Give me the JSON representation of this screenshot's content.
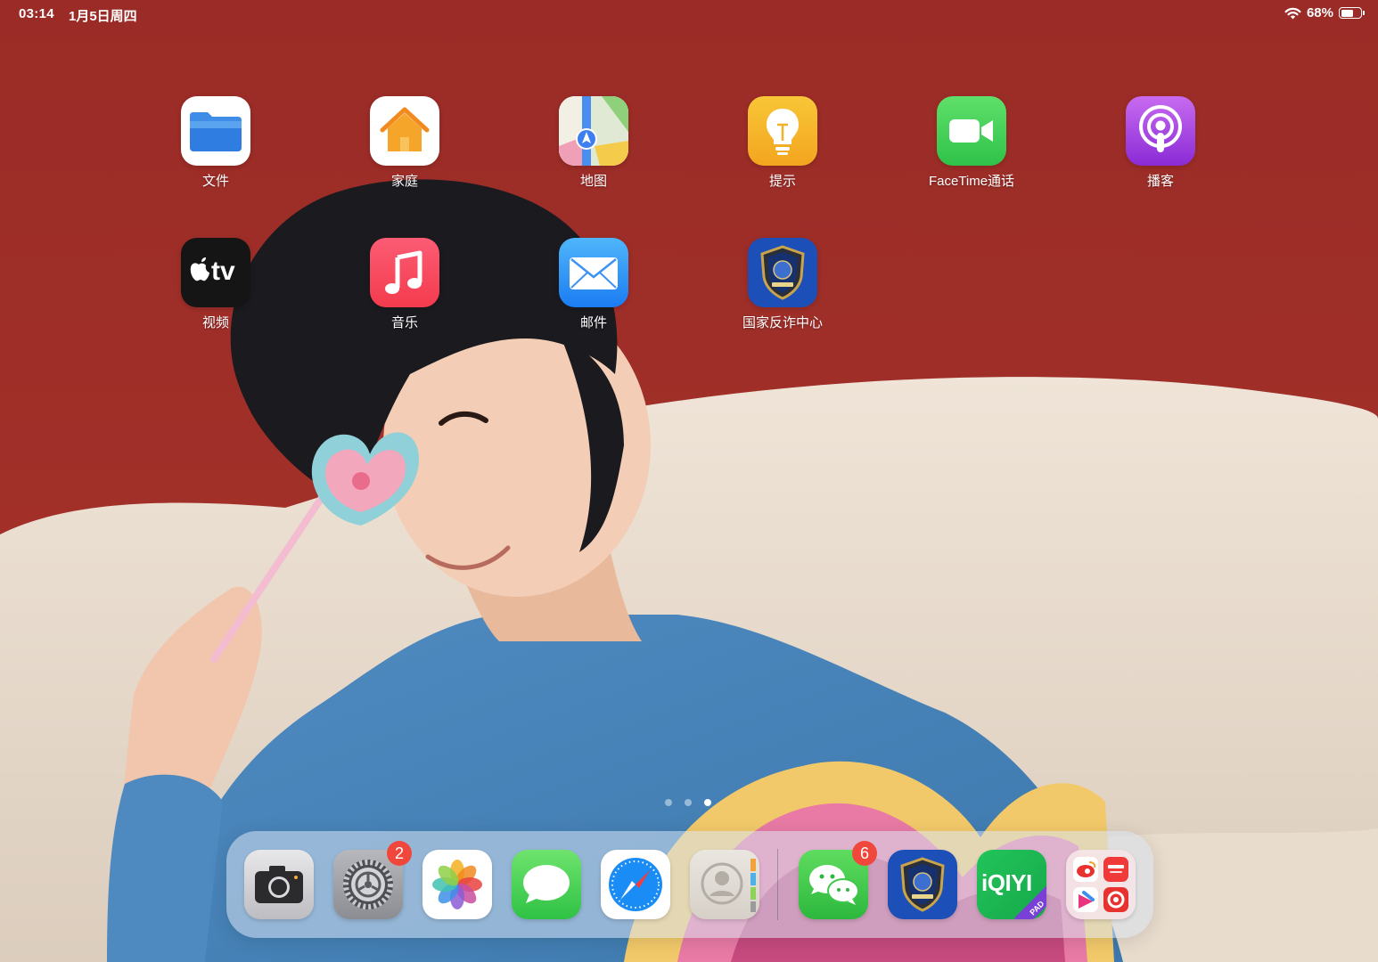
{
  "status_bar": {
    "time": "03:14",
    "date": "1月5日周四",
    "battery_percent": "68%",
    "battery_level": 0.68
  },
  "apps": [
    {
      "label": "文件",
      "icon": "files-folder-icon"
    },
    {
      "label": "家庭",
      "icon": "home-house-icon"
    },
    {
      "label": "地图",
      "icon": "maps-icon"
    },
    {
      "label": "提示",
      "icon": "tips-lightbulb-icon"
    },
    {
      "label": "FaceTime通话",
      "icon": "facetime-camera-icon"
    },
    {
      "label": "播客",
      "icon": "podcasts-icon"
    },
    {
      "label": "视频",
      "icon": "apple-tv-icon",
      "icon_text": "tv"
    },
    {
      "label": "音乐",
      "icon": "music-note-icon"
    },
    {
      "label": "邮件",
      "icon": "mail-envelope-icon"
    },
    {
      "label": "国家反诈中心",
      "icon": "anti-fraud-shield-icon"
    }
  ],
  "page_dots": {
    "count": 3,
    "active_index": 2
  },
  "dock": {
    "items": [
      {
        "app": "camera",
        "icon": "camera-icon"
      },
      {
        "app": "settings",
        "icon": "settings-gear-icon",
        "badge": "2"
      },
      {
        "app": "photos",
        "icon": "photos-flower-icon"
      },
      {
        "app": "messages",
        "icon": "messages-bubble-icon"
      },
      {
        "app": "safari",
        "icon": "safari-compass-icon"
      },
      {
        "app": "contacts",
        "icon": "contacts-person-icon"
      },
      {
        "app": "wechat",
        "icon": "wechat-bubbles-icon",
        "badge": "6"
      },
      {
        "app": "anti-fraud",
        "icon": "anti-fraud-shield-icon"
      },
      {
        "app": "iqiyi",
        "icon": "iqiyi-icon",
        "icon_text": "iQIYI",
        "icon_subtext": "PAD"
      },
      {
        "app": "app-folder",
        "icon": "app-folder-icon"
      }
    ]
  },
  "colors": {
    "wallpaper_red": "#9c2d28",
    "badge_red": "#f0473c",
    "dock_tint": "#d7e1f0"
  }
}
